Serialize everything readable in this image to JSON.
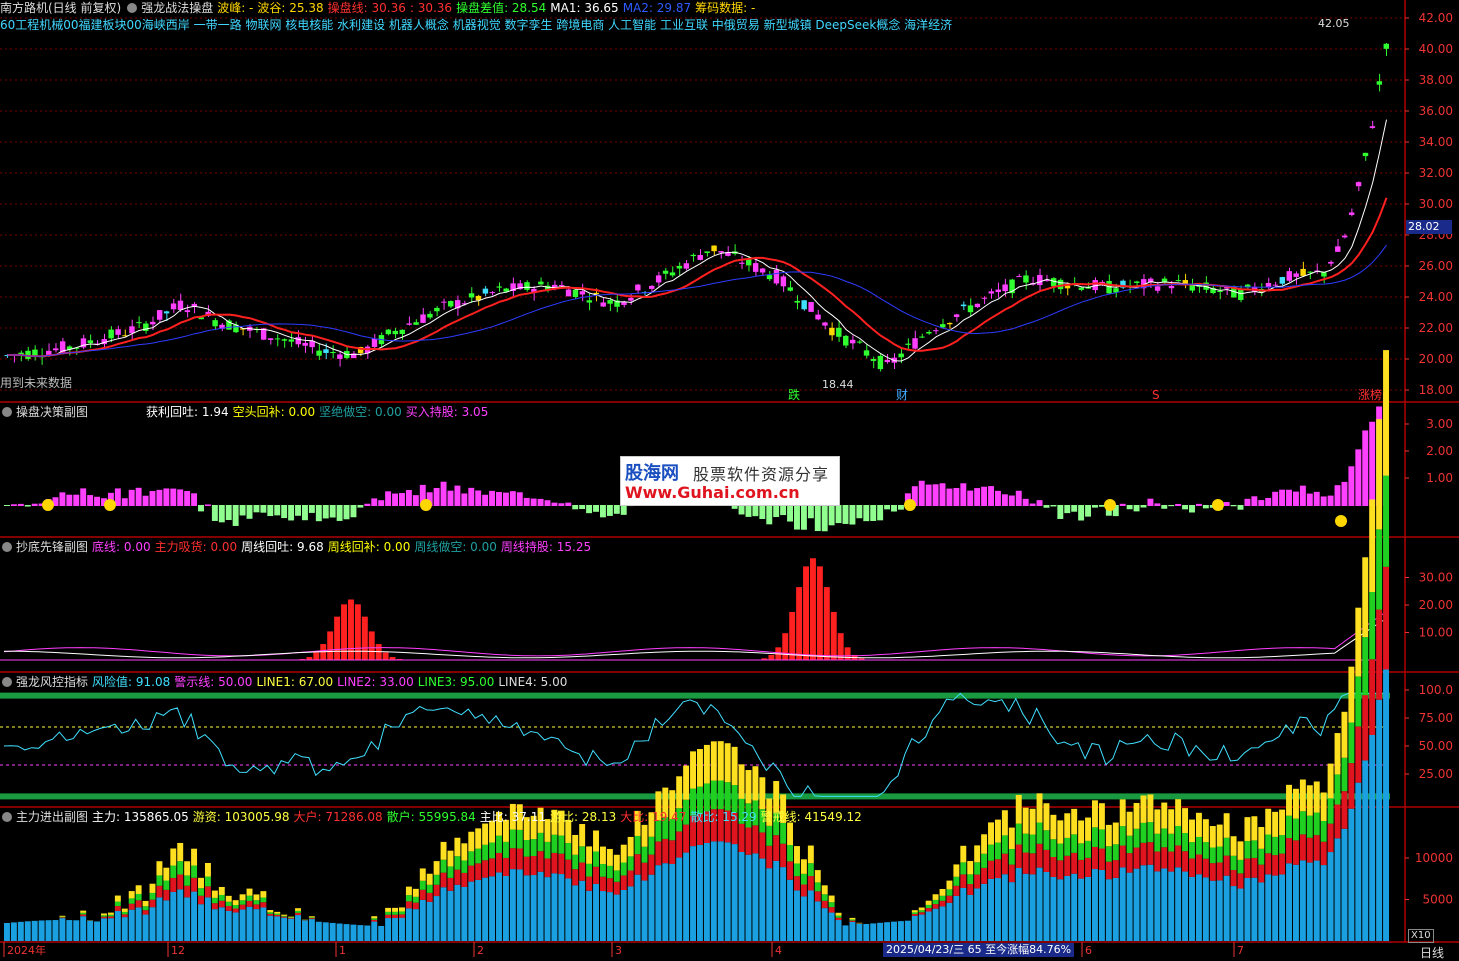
{
  "main_header": {
    "title": "南方路机(日线 前复权)",
    "indicator": "强龙战法操盘",
    "items": [
      {
        "label": "波峰:",
        "value": "-",
        "color": "#ffd700"
      },
      {
        "label": "波谷:",
        "value": "25.38",
        "color": "#ffd700"
      },
      {
        "label": "操盘线:",
        "value": "30.36",
        "color": "#ff3030"
      },
      {
        "label": ":",
        "value": "30.36",
        "color": "#ff3030"
      },
      {
        "label": "操盘差值:",
        "value": "28.54",
        "color": "#30ff30"
      },
      {
        "label": "MA1:",
        "value": "36.65",
        "color": "#ffffff"
      },
      {
        "label": "MA2:",
        "value": "29.87",
        "color": "#2e5bff"
      },
      {
        "label": "筹码数据:",
        "value": "-",
        "color": "#ffd700"
      }
    ]
  },
  "concepts": "60工程机械00福建板块00海峡西岸 一带一路 物联网 核电核能 水利建设 机器人概念 机器视觉 数字孪生 跨境电商 人工智能 工业互联 中俄贸易 新型城镇 DeepSeek概念 海洋经济",
  "future_data_note": "用到未来数据",
  "main_axis": [
    "42.00",
    "40.00",
    "38.00",
    "36.00",
    "34.00",
    "32.00",
    "30.00",
    "28.00",
    "26.00",
    "24.00",
    "22.00",
    "20.00",
    "18.00"
  ],
  "price_tag": "28.02",
  "high_label": "42.05",
  "low_label": "18.44",
  "event_marks": [
    {
      "text": "跌",
      "color": "#30ff30"
    },
    {
      "text": "财",
      "color": "#3fa9ff"
    },
    {
      "text": "S",
      "color": "#ff3030"
    },
    {
      "text": "涨榜",
      "color": "#ff3030"
    }
  ],
  "panel2": {
    "title": "操盘决策副图",
    "items": [
      {
        "label": "获利回吐:",
        "value": "1.94",
        "color": "#ffffff"
      },
      {
        "label": "空头回补:",
        "value": "0.00",
        "color": "#ffff00"
      },
      {
        "label": "坚绝做空:",
        "value": "0.00",
        "color": "#20a0a0"
      },
      {
        "label": "买入持股:",
        "value": "3.05",
        "color": "#ff40ff"
      }
    ],
    "axis": [
      "3.00",
      "2.00",
      "1.00"
    ]
  },
  "panel3": {
    "title": "抄底先锋副图",
    "items": [
      {
        "label": "底线:",
        "value": "0.00",
        "color": "#ff40ff"
      },
      {
        "label": "主力吸货:",
        "value": "0.00",
        "color": "#ff3030"
      },
      {
        "label": "周线回吐:",
        "value": "9.68",
        "color": "#ffffff"
      },
      {
        "label": "周线回补:",
        "value": "0.00",
        "color": "#ffff00"
      },
      {
        "label": "周线做空:",
        "value": "0.00",
        "color": "#20a0a0"
      },
      {
        "label": "周线持股:",
        "value": "15.25",
        "color": "#ff40ff"
      }
    ],
    "axis": [
      "30.00",
      "20.00",
      "10.00"
    ]
  },
  "panel4": {
    "title": "强龙风控指标",
    "items": [
      {
        "label": "风险值:",
        "value": "91.08",
        "color": "#40e0ff"
      },
      {
        "label": "警示线:",
        "value": "50.00",
        "color": "#ff40ff"
      },
      {
        "label": "LINE1:",
        "value": "67.00",
        "color": "#ffff40"
      },
      {
        "label": "LINE2:",
        "value": "33.00",
        "color": "#ff40ff"
      },
      {
        "label": "LINE3:",
        "value": "95.00",
        "color": "#30ff30"
      },
      {
        "label": "LINE4:",
        "value": "5.00",
        "color": "#dddddd"
      }
    ],
    "axis": [
      "100.0",
      "75.00",
      "50.00",
      "25.00"
    ]
  },
  "panel5": {
    "title": "主力进出副图",
    "items": [
      {
        "label": "主力:",
        "value": "135865.05",
        "color": "#ffffff"
      },
      {
        "label": "游资:",
        "value": "103005.98",
        "color": "#ffff40"
      },
      {
        "label": "大户:",
        "value": "71286.08",
        "color": "#ff3030"
      },
      {
        "label": "散户:",
        "value": "55995.84",
        "color": "#30ff30"
      },
      {
        "label": "主比:",
        "value": "37.11",
        "color": "#ffffff"
      },
      {
        "label": "游比:",
        "value": "28.13",
        "color": "#ffff40"
      },
      {
        "label": "大比:",
        "value": "19.47",
        "color": "#ff3030"
      },
      {
        "label": "散比:",
        "value": "15.29",
        "color": "#40e0ff"
      },
      {
        "label": "警戒线:",
        "value": "41549.12",
        "color": "#ffff40"
      }
    ],
    "axis": [
      "10000",
      "5000"
    ],
    "scale": "X10"
  },
  "date_axis": [
    {
      "label": "2024年"
    },
    {
      "label": "12"
    },
    {
      "label": "1"
    },
    {
      "label": "2"
    },
    {
      "label": "3"
    },
    {
      "label": "4"
    },
    {
      "label": "6"
    },
    {
      "label": "7"
    }
  ],
  "bottom_status": "2025/04/23/三 65 至今涨幅84.76%",
  "period": "日线",
  "watermark": {
    "brand": "股海网",
    "slogan": "股票软件资源分享",
    "url": "Www.Guhai.com.cn"
  },
  "colors": {
    "up": "#ff3030",
    "down": "#30ff30",
    "grid": "#7a0000",
    "axis": "#e33"
  }
}
